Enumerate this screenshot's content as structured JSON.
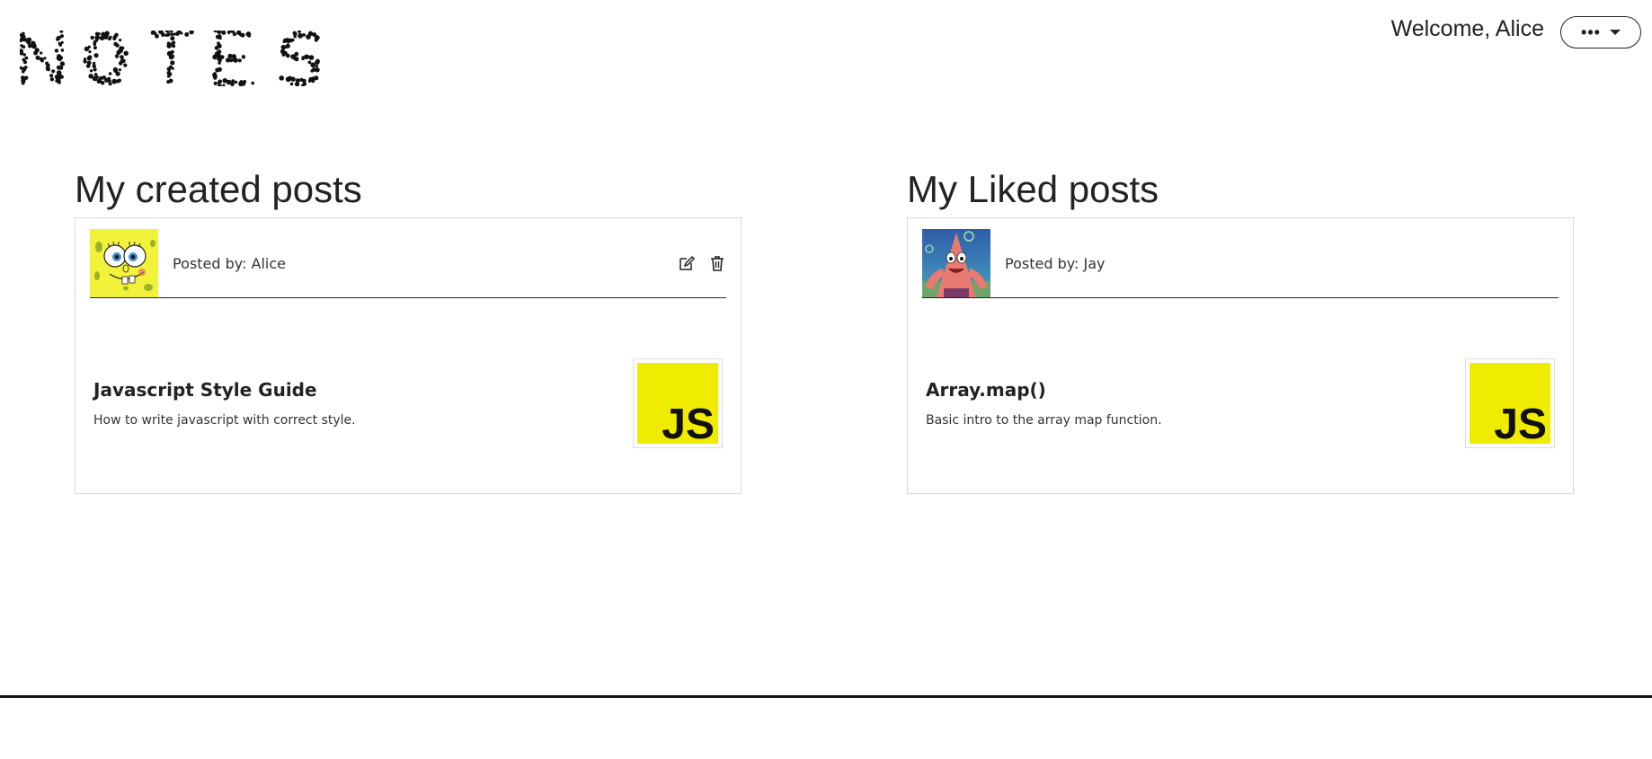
{
  "header": {
    "logo_text": "NOTES",
    "welcome_text": "Welcome, Alice",
    "menu_icon": "more-dots-icon"
  },
  "created": {
    "title": "My created posts",
    "posts": [
      {
        "posted_by": "Posted by: Alice",
        "avatar": "spongebob-avatar",
        "title": "Javascript Style Guide",
        "description": "How to write javascript with correct style.",
        "thumbnail_text": "JS",
        "thumbnail_color": "#F0EC00"
      }
    ]
  },
  "liked": {
    "title": "My Liked posts",
    "posts": [
      {
        "posted_by": "Posted by: Jay",
        "avatar": "patrick-avatar",
        "title": "Array.map()",
        "description": "Basic intro to the array map function.",
        "thumbnail_text": "JS",
        "thumbnail_color": "#F0EC00"
      }
    ]
  },
  "colors": {
    "js_yellow": "#F0EC00",
    "spongebob_yellow": "#F3F23B",
    "patrick_pink": "#E97A70",
    "text": "#222222"
  }
}
